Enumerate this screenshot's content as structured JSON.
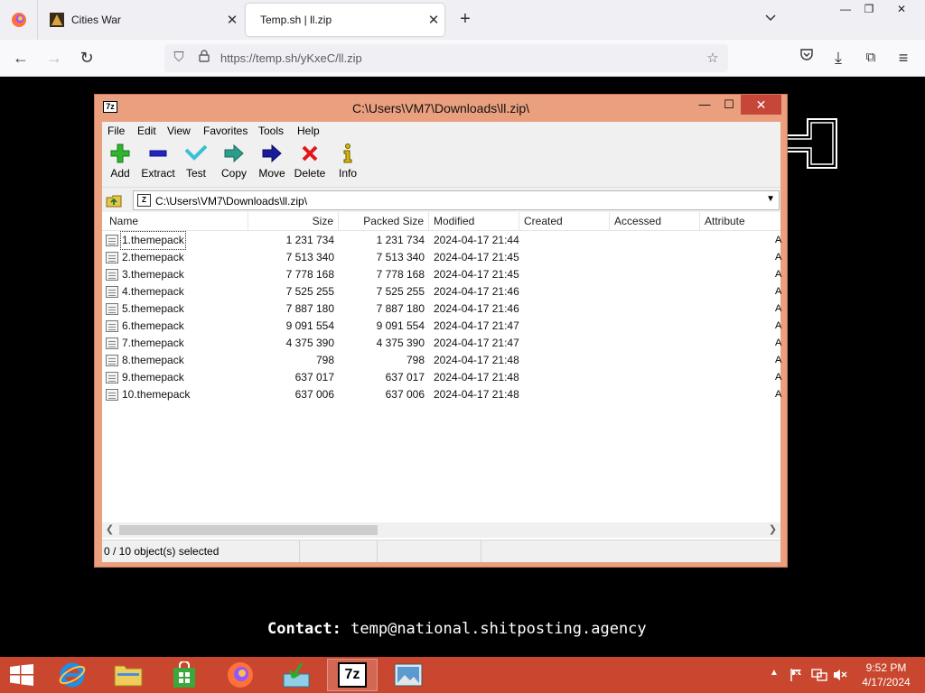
{
  "browser": {
    "tabs": [
      {
        "label": "Cities War"
      },
      {
        "label": "Temp.sh | ll.zip"
      }
    ],
    "url": "https://temp.sh/yKxeC/ll.zip"
  },
  "page": {
    "contact_label": "Contact:",
    "contact_email": "temp@national.shitposting.agency"
  },
  "app": {
    "title": "C:\\Users\\VM7\\Downloads\\ll.zip\\",
    "icon_text": "7z",
    "menu": [
      "File",
      "Edit",
      "View",
      "Favorites",
      "Tools",
      "Help"
    ],
    "toolbar": [
      "Add",
      "Extract",
      "Test",
      "Copy",
      "Move",
      "Delete",
      "Info"
    ],
    "address": "C:\\Users\\VM7\\Downloads\\ll.zip\\",
    "columns": [
      "Name",
      "Size",
      "Packed Size",
      "Modified",
      "Created",
      "Accessed",
      "Attribute"
    ],
    "files": [
      {
        "name": "1.themepack",
        "size": "1 231 734",
        "packed": "1 231 734",
        "modified": "2024-04-17 21:44",
        "attr": "A"
      },
      {
        "name": "2.themepack",
        "size": "7 513 340",
        "packed": "7 513 340",
        "modified": "2024-04-17 21:45",
        "attr": "A"
      },
      {
        "name": "3.themepack",
        "size": "7 778 168",
        "packed": "7 778 168",
        "modified": "2024-04-17 21:45",
        "attr": "A"
      },
      {
        "name": "4.themepack",
        "size": "7 525 255",
        "packed": "7 525 255",
        "modified": "2024-04-17 21:46",
        "attr": "A"
      },
      {
        "name": "5.themepack",
        "size": "7 887 180",
        "packed": "7 887 180",
        "modified": "2024-04-17 21:46",
        "attr": "A"
      },
      {
        "name": "6.themepack",
        "size": "9 091 554",
        "packed": "9 091 554",
        "modified": "2024-04-17 21:47",
        "attr": "A"
      },
      {
        "name": "7.themepack",
        "size": "4 375 390",
        "packed": "4 375 390",
        "modified": "2024-04-17 21:47",
        "attr": "A"
      },
      {
        "name": "8.themepack",
        "size": "798",
        "packed": "798",
        "modified": "2024-04-17 21:48",
        "attr": "A"
      },
      {
        "name": "9.themepack",
        "size": "637 017",
        "packed": "637 017",
        "modified": "2024-04-17 21:48",
        "attr": "A"
      },
      {
        "name": "10.themepack",
        "size": "637 006",
        "packed": "637 006",
        "modified": "2024-04-17 21:48",
        "attr": "A"
      }
    ],
    "status": "0 / 10 object(s) selected"
  },
  "taskbar": {
    "time": "9:52 PM",
    "date": "4/17/2024",
    "sevenzip_label": "7z"
  }
}
